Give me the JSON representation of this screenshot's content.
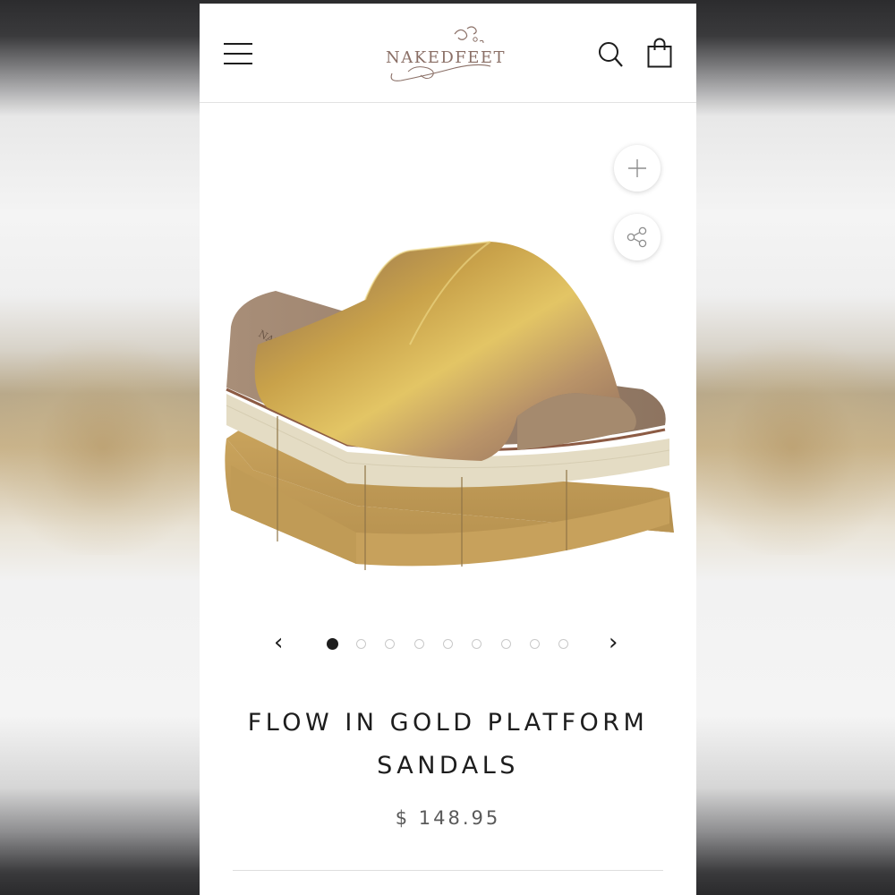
{
  "brand": {
    "logo_text": "NAKEDFEET"
  },
  "header": {
    "menu_icon": "hamburger-menu-icon",
    "search_icon": "search-icon",
    "bag_icon": "shopping-bag-icon"
  },
  "gallery": {
    "zoom_icon": "plus-icon",
    "share_icon": "share-icon",
    "image_count": 9,
    "active_index": 0,
    "prev_label": "‹",
    "next_label": "›"
  },
  "product": {
    "title_line1": "FLOW IN GOLD PLATFORM",
    "title_line2": "SANDALS",
    "price": "$ 148.95"
  },
  "colors": {
    "logo": "#8a6f66",
    "text": "#1d1d1d",
    "price": "#5a5a5a"
  }
}
